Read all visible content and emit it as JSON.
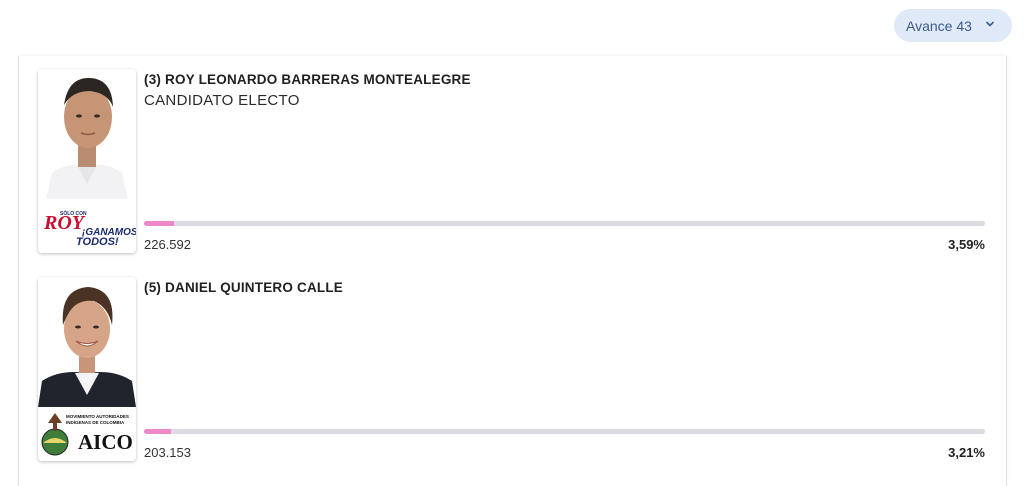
{
  "header": {
    "avance_label": "Avance 43",
    "chevron_icon": "chevron-down-icon"
  },
  "candidates": [
    {
      "name": "(3) ROY LEONARDO BARRERAS MONTEALEGRE",
      "status": "CANDIDATO ELECTO",
      "votes": "226.592",
      "percent": "3,59%",
      "bar_fraction": 0.0359,
      "logo_text": {
        "small": "SÓLO CON",
        "big": "ROY",
        "slogan1": "¡GANAMOS",
        "slogan2": "TODOS!"
      }
    },
    {
      "name": "(5) DANIEL QUINTERO CALLE",
      "status": "",
      "votes": "203.153",
      "percent": "3,21%",
      "bar_fraction": 0.0321,
      "logo_text": {
        "line1": "MOVIMIENTO AUTORIDADES",
        "line2": "INDÍGENAS DE COLOMBIA",
        "big": "AICO"
      }
    }
  ],
  "colors": {
    "accent_bar": "#ec88c8",
    "bar_track": "#dcdbe3",
    "pill_bg": "#dfe9f8",
    "roy_red": "#c8102e",
    "roy_blue": "#1a2b6d"
  }
}
